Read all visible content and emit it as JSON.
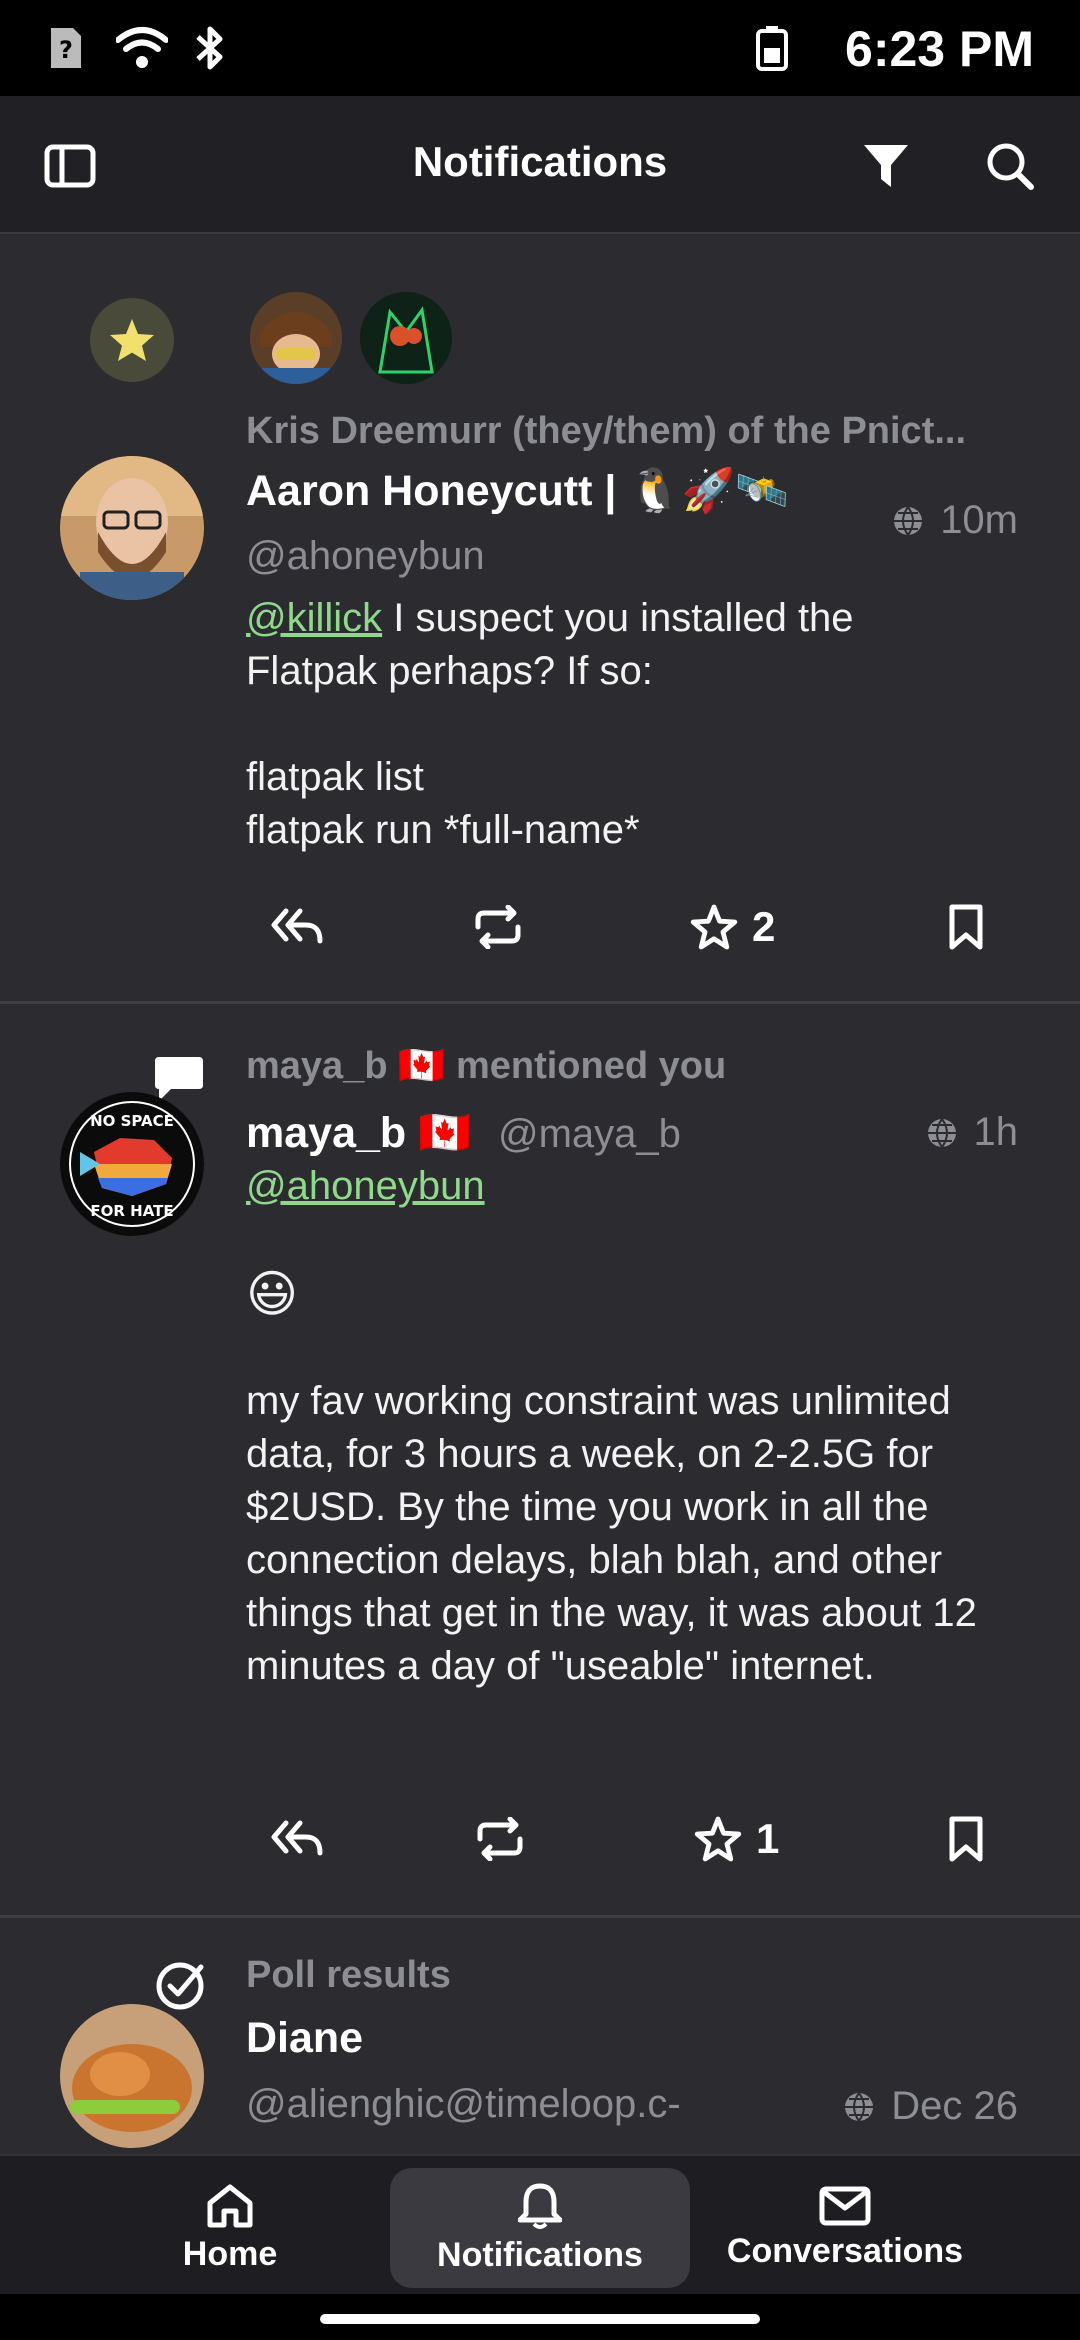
{
  "status_bar": {
    "time": "6:23 PM",
    "icons": [
      "sim-unknown-icon",
      "wifi-icon",
      "bluetooth-icon",
      "battery-icon"
    ]
  },
  "app_bar": {
    "title": "Notifications",
    "icons": [
      "sidebar-toggle-icon",
      "filter-icon",
      "search-icon"
    ]
  },
  "notifications": [
    {
      "type": "favourite",
      "type_icon": "star-icon",
      "context": "Kris Dreemurr (they/them) of the Pnict...",
      "author": {
        "display_name": "Aaron Honeycutt | 🐧🚀🛰️",
        "handle": "@ahoneybun"
      },
      "visibility_icon": "globe-icon",
      "time": "10m",
      "body": {
        "mention": "@killick",
        "line1_rest": " I suspect you installed the",
        "line2": "Flatpak perhaps? If so:",
        "line3": "flatpak list",
        "line4": "flatpak run *full-name*"
      },
      "stats": {
        "favourites": "2"
      }
    },
    {
      "type": "mention",
      "type_icon": "speech-bubble-icon",
      "context": "maya_b 🇨🇦 mentioned you",
      "author": {
        "display_name": "maya_b 🇨🇦",
        "handle": "@maya_b"
      },
      "visibility_icon": "globe-icon",
      "time": "1h",
      "body": {
        "mention": "@ahoneybun",
        "emoji": "😃",
        "paragraph": "my fav working constraint was unlimited data, for 3 hours a week, on 2-2.5G for $2USD. By the time you work in all the connection delays, blah blah, and other things that get in the way, it was about 12 minutes a day of \"useable\" internet."
      },
      "stats": {
        "favourites": "1"
      }
    },
    {
      "type": "poll",
      "type_icon": "check-circle-icon",
      "context": "Poll results",
      "author": {
        "display_name": "Diane",
        "handle": "@alienghic@timeloop.c-"
      },
      "visibility_icon": "globe-icon",
      "time": "Dec 26"
    }
  ],
  "bottom_nav": {
    "items": [
      {
        "label": "Home",
        "icon": "home-icon"
      },
      {
        "label": "Notifications",
        "icon": "bell-icon",
        "active": true
      },
      {
        "label": "Conversations",
        "icon": "mail-icon"
      }
    ]
  },
  "colors": {
    "background": "#2b2b30",
    "app_bar": "#212125",
    "mention": "#8fd98a",
    "muted_text": "#8d8d94",
    "star_badge": "#f1e06b"
  }
}
